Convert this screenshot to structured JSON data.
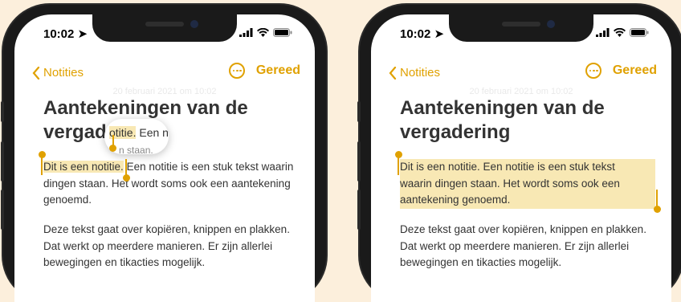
{
  "status_bar": {
    "time": "10:02"
  },
  "left_phone": {
    "nav": {
      "back_label": "Notities",
      "done_label": "Gereed"
    },
    "ghost_text": "20 februari 2021 om 10:02",
    "title_line1": "Aantekeningen van de",
    "title_line2": "vergad",
    "magnifier": {
      "pre": "",
      "selected": "otitie.",
      "post": " Een n",
      "below": "n staan."
    },
    "para1": {
      "selected": "Dit is een notitie.",
      "rest": " Een notitie is een stuk tekst waarin dingen staan. Het wordt soms ook een aantekening genoemd."
    },
    "para2": "Deze tekst gaat over kopiëren, knippen en plakken. Dat werkt op meerdere manieren. Er zijn allerlei bewegingen en tikacties mogelijk."
  },
  "right_phone": {
    "nav": {
      "back_label": "Notities",
      "done_label": "Gereed"
    },
    "ghost_text": "20 februari 2021 om 10:02",
    "title_line1": "Aantekeningen van de",
    "title_line2": "vergadering",
    "para1": {
      "line1": "Dit is een notitie. Een notitie is een stuk tekst",
      "line2": "waarin dingen staan. Het wordt soms ook een",
      "line3": "aantekening genoemd."
    },
    "para2": "Deze tekst gaat over kopiëren, knippen en plakken. Dat werkt op meerdere manieren. Er zijn allerlei bewegingen en tikacties mogelijk."
  },
  "colors": {
    "accent": "#e0a100",
    "selection": "#f8e8b4",
    "background": "#fcefdc"
  }
}
